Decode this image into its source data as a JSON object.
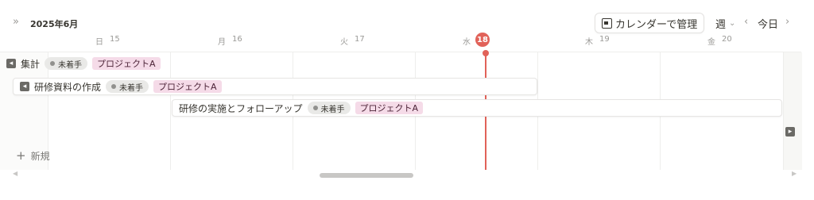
{
  "header": {
    "month_label": "2025年6月",
    "nav_expand_icon": "»",
    "calendar_manage_label": "カレンダーで管理",
    "view_label": "週",
    "today_label": "今日"
  },
  "days": [
    {
      "weekday": "日",
      "day": "15"
    },
    {
      "weekday": "月",
      "day": "16"
    },
    {
      "weekday": "火",
      "day": "17"
    },
    {
      "weekday": "水",
      "day": "18"
    },
    {
      "weekday": "木",
      "day": "19"
    },
    {
      "weekday": "金",
      "day": "20"
    }
  ],
  "events": [
    {
      "title": "集計",
      "status": "未着手",
      "project": "プロジェクトA"
    },
    {
      "title": "研修資料の作成",
      "status": "未着手",
      "project": "プロジェクトA"
    },
    {
      "title": "研修の実施とフォローアップ",
      "status": "未着手",
      "project": "プロジェクトA"
    }
  ],
  "new_label": "新規",
  "colors": {
    "today_accent": "#e16259",
    "project_tag": "#f5dbe8",
    "status_tag": "#e9e9e7"
  }
}
